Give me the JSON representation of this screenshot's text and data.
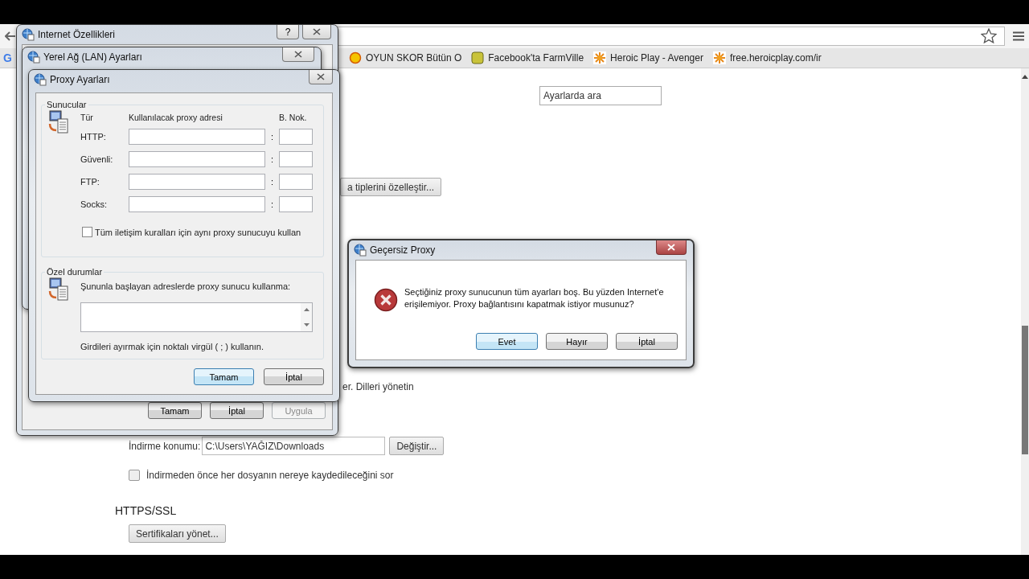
{
  "browser": {
    "bookmarks_bar": {
      "leading": "G",
      "items": [
        {
          "label": "OYUN SKOR Bütün O",
          "kind": "circle"
        },
        {
          "label": "Facebook'ta FarmVille",
          "kind": "tile"
        },
        {
          "label": "Heroic Play - Avenger",
          "kind": "burst"
        },
        {
          "label": "free.heroicplay.com/ir",
          "kind": "burst"
        }
      ]
    },
    "settings": {
      "search": {
        "placeholder": "Ayarlarda ara"
      },
      "customize_button": "a tiplerini özelleştir...",
      "languages_text": "er. Dilleri yönetin",
      "download_label": "İndirme konumu:",
      "download_path": "C:\\Users\\YAĞIZ\\Downloads",
      "change_button": "Değiştir...",
      "ask_checkbox": {
        "label": "İndirmeden önce her dosyanın nereye kaydedileceğini sor",
        "checked": false
      },
      "https_heading": "HTTPS/SSL",
      "certificates_button": "Sertifikaları yönet..."
    }
  },
  "internet_options": {
    "title": "Internet Özellikleri",
    "help": "?",
    "buttons": [
      {
        "label": "Tamam",
        "disabled": false,
        "default": false
      },
      {
        "label": "İptal",
        "disabled": false,
        "default": false
      },
      {
        "label": "Uygula",
        "disabled": true,
        "default": false
      }
    ]
  },
  "lan_settings": {
    "title": "Yerel Ağ (LAN) Ayarları"
  },
  "proxy_settings": {
    "title": "Proxy Ayarları",
    "servers": {
      "legend": "Sunucular",
      "headers": [
        "Tür",
        "Kullanılacak proxy adresi",
        "B. Nok."
      ],
      "rows": [
        {
          "label": "HTTP:",
          "separator": ":"
        },
        {
          "label": "Güvenli:",
          "separator": ":"
        },
        {
          "label": "FTP:",
          "separator": ":"
        },
        {
          "label": "Socks:",
          "separator": ":"
        }
      ],
      "same_proxy": {
        "label": "Tüm iletişim kuralları için aynı proxy sunucuyu kullan",
        "checked": false
      }
    },
    "exceptions": {
      "legend": "Özel durumlar",
      "prompt": "Şununla başlayan adreslerde proxy sunucu kullanma:",
      "hint": "Girdileri ayırmak için noktalı virgül ( ; ) kullanın."
    },
    "buttons": [
      {
        "label": "Tamam",
        "disabled": false,
        "default": true
      },
      {
        "label": "İptal",
        "disabled": false,
        "default": false
      }
    ]
  },
  "error_dialog": {
    "title": "Geçersiz Proxy",
    "message": "Seçtiğiniz proxy sunucunun tüm ayarları boş. Bu yüzden Internet'e erişilemiyor. Proxy bağlantısını kapatmak istiyor musunuz?",
    "buttons": [
      {
        "label": "Evet",
        "disabled": false,
        "default": true
      },
      {
        "label": "Hayır",
        "disabled": false,
        "default": false
      },
      {
        "label": "İptal",
        "disabled": false,
        "default": false
      }
    ]
  }
}
